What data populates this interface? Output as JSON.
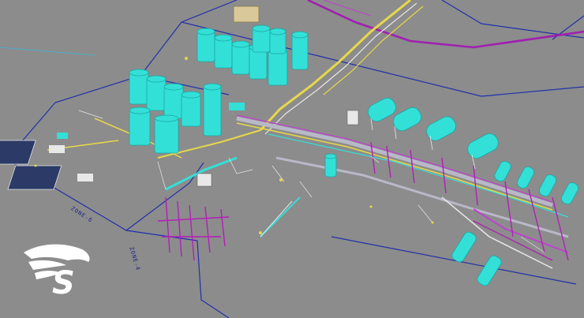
{
  "viewport": {
    "background": "#8c8c8c"
  },
  "labels": {
    "zone_a": "ZONE-6",
    "zone_b": "ZONE-4"
  },
  "logo": {
    "glyph": "S",
    "icon": "eagle-head-logo-icon"
  },
  "colors": {
    "tank": "#33e0d8",
    "tank_shadow": "#1aa7a2",
    "pipe_yellow": "#e6d84a",
    "pipe_magenta": "#b21fb8",
    "pipe_white": "#e8e8e8",
    "zone_border": "#2230a8",
    "pipe_rack_gray": "#b8b8c8"
  }
}
